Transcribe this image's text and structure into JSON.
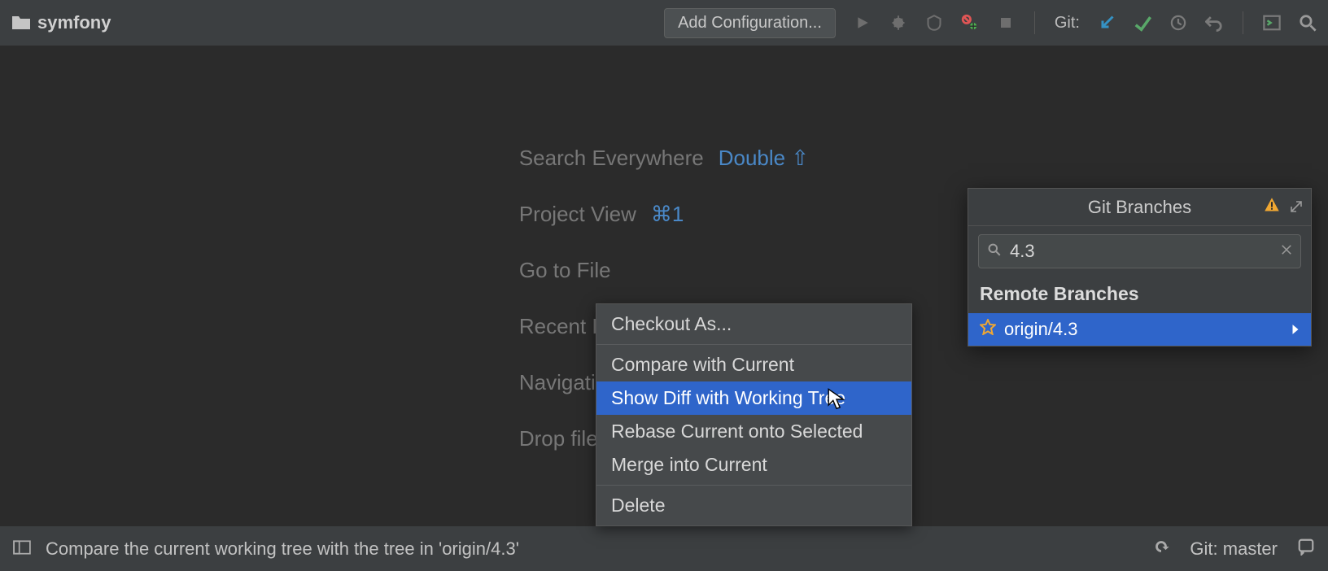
{
  "toolbar": {
    "project_name": "symfony",
    "add_configuration_label": "Add Configuration...",
    "git_label": "Git:"
  },
  "hints": {
    "search_everywhere": {
      "label": "Search Everywhere",
      "shortcut": "Double ⇧"
    },
    "project_view": {
      "label": "Project View",
      "shortcut": "⌘1"
    },
    "go_to_file": {
      "label": "Go to File",
      "shortcut": ""
    },
    "recent_files": {
      "label": "Recent Files",
      "shortcut": ""
    },
    "navigation": {
      "label": "Navigation",
      "shortcut": ""
    },
    "drop_hint": "Drop files here to open"
  },
  "context_menu": {
    "items": [
      "Checkout As...",
      "Compare with Current",
      "Show Diff with Working Tree",
      "Rebase Current onto Selected",
      "Merge into Current",
      "Delete"
    ],
    "selected_index": 2
  },
  "branches_popup": {
    "title": "Git Branches",
    "search_value": "4.3",
    "section_label": "Remote Branches",
    "branches": [
      {
        "name": "origin/4.3",
        "favorite": true
      }
    ]
  },
  "status_bar": {
    "message": "Compare the current working tree with the tree in 'origin/4.3'",
    "git_branch": "Git: master"
  }
}
